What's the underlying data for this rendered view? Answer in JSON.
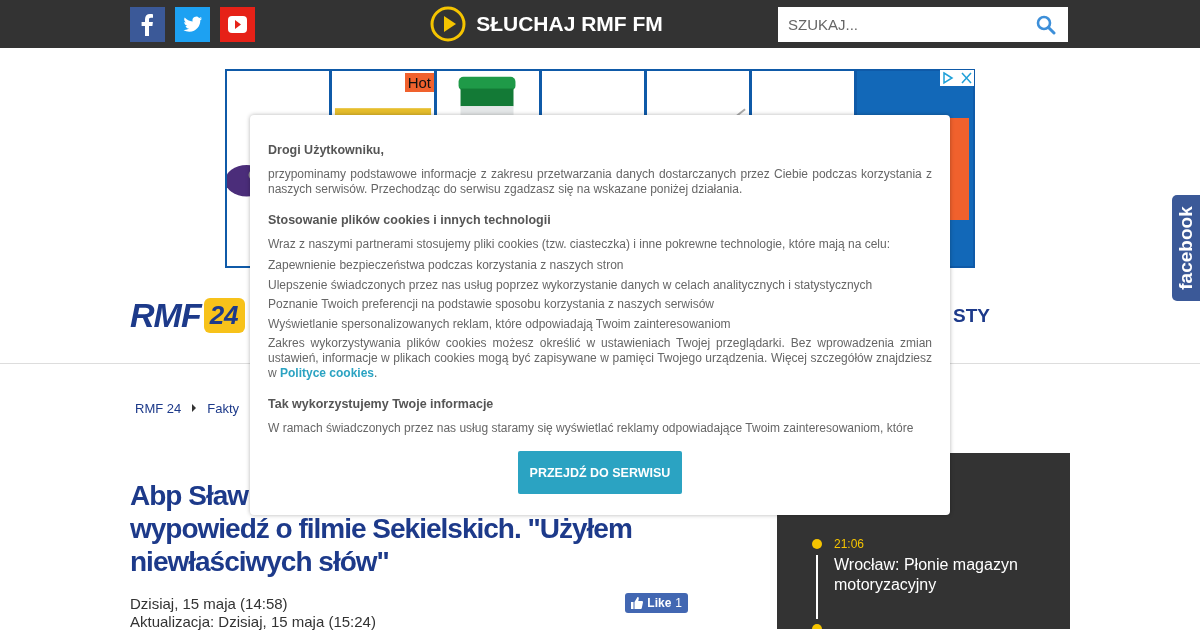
{
  "header": {
    "social": [
      {
        "kind": "facebook"
      },
      {
        "kind": "twitter"
      },
      {
        "kind": "youtube"
      }
    ],
    "listen_label": "SŁUCHAJ RMF FM",
    "search": {
      "placeholder": "SZUKAJ..."
    }
  },
  "ad": {
    "badge": "Hot"
  },
  "site": {
    "logo_text": "RMF",
    "logo_badge": "24",
    "nav_fragment": "STY"
  },
  "breadcrumb": [
    "RMF 24",
    "Fakty"
  ],
  "article": {
    "title_lines": [
      "Abp Sław",
      "wypowiedź o filmie Sekielskich. \"Użyłem",
      "niewłaściwych słów\""
    ],
    "date": "Dzisiaj, 15 maja (14:58)",
    "updated": "Aktualizacja: Dzisiaj, 15 maja (15:24)",
    "like_label": "Like",
    "like_count": "1"
  },
  "news_feed": [
    {
      "time": "21:06",
      "title": "Wrocław: Płonie magazyn motoryzacyjny"
    }
  ],
  "side_tab": "facebook",
  "cookie_dialog": {
    "greeting": "Drogi Użytkowniku,",
    "intro": "przypominamy podstawowe informacje z zakresu przetwarzania danych dostarczanych przez Ciebie podczas korzystania z naszych serwisów. Przechodząc do serwisu zgadzasz się na wskazane poniżej działania.",
    "section_1": "Stosowanie plików cookies i innych technologii",
    "lead": "Wraz z naszymi partnerami stosujemy pliki cookies (tzw. ciasteczka) i inne pokrewne technologie, które mają na celu:",
    "purposes": [
      "Zapewnienie bezpieczeństwa podczas korzystania z naszych stron",
      "Ulepszenie świadczonych przez nas usług poprzez wykorzystanie danych w celach analitycznych i statystycznych",
      "Poznanie Twoich preferencji na podstawie sposobu korzystania z naszych serwisów",
      "Wyświetlanie spersonalizowanych reklam, które odpowiadają Twoim zainteresowaniom"
    ],
    "settings_text": "Zakres wykorzystywania plików cookies możesz określić w ustawieniach Twojej przeglądarki. Bez wprowadzenia zmian ustawień, informacje w plikach cookies mogą być zapisywane w pamięci Twojego urządzenia. Więcej szczegółów znajdziesz w",
    "policy_link": "Polityce cookies",
    "policy_end": ".",
    "section_2": "Tak wykorzystujemy Twoje informacje",
    "cut_text": "W ramach świadczonych przez nas usług staramy się wyświetlać reklamy odpowiadające Twoim zainteresowaniom, które",
    "button": "PRZEJDŹ DO SERWISU"
  }
}
